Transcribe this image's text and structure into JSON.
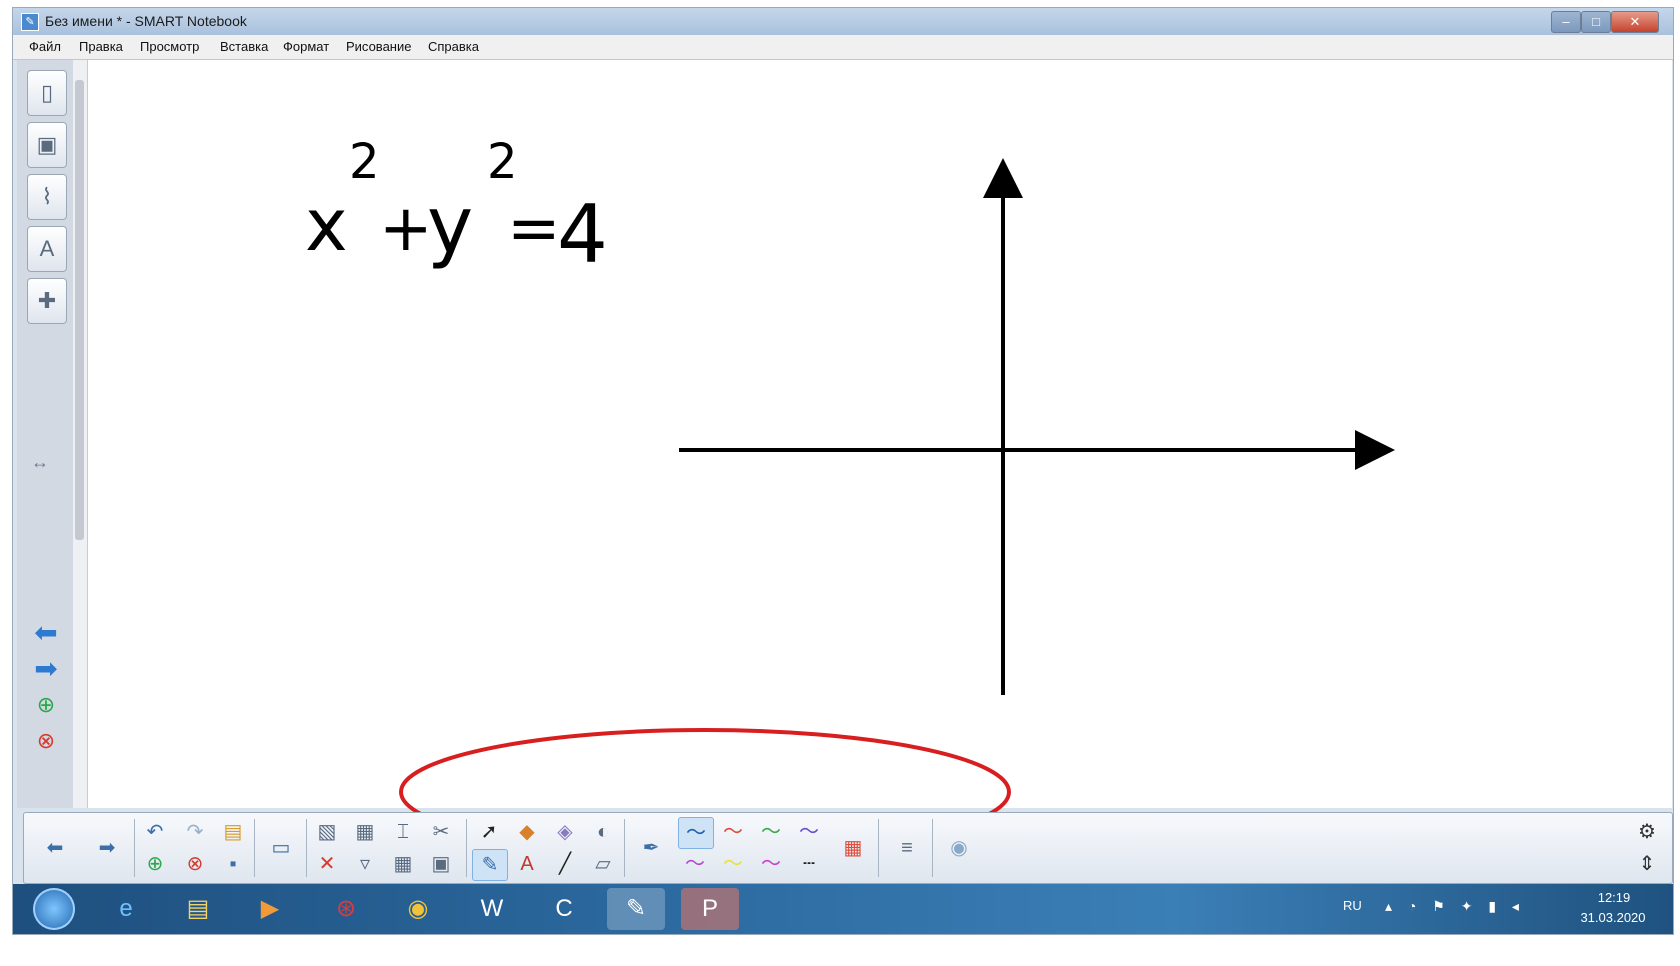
{
  "window": {
    "title": "Без имени * - SMART Notebook"
  },
  "menu": [
    "Файл",
    "Правка",
    "Просмотр",
    "Вставка",
    "Формат",
    "Рисование",
    "Справка"
  ],
  "canvas": {
    "equation": {
      "x": "x",
      "exp1": "2",
      "plus": "+",
      "y": "y",
      "exp2": "2",
      "equals": "=",
      "rhs": "4"
    }
  },
  "taskbar": {
    "language": "RU",
    "time": "12:19",
    "date": "31.03.2020"
  },
  "colors": {
    "accent": "#2f7ad1",
    "highlight_ellipse": "#d81e1e",
    "pen_black": "#000000"
  },
  "icons": {
    "sidebar": [
      "page-sorter-icon",
      "gallery-icon",
      "attachments-icon",
      "properties-icon",
      "addons-icon"
    ],
    "toolbar": [
      "back-icon",
      "forward-icon",
      "undo-icon",
      "redo-icon",
      "open-icon",
      "add-page-icon",
      "delete-page-icon",
      "save-icon",
      "display-icon",
      "paste-icon",
      "screen-shade-icon",
      "insert-table-icon",
      "delete-icon",
      "capture-icon",
      "select-icon",
      "pens-icon",
      "shapes-icon",
      "text-icon",
      "eraser-icon",
      "lines-icon",
      "color-icon",
      "line-style-icon",
      "transparency-icon",
      "settings-icon",
      "move-toolbar-icon"
    ]
  }
}
